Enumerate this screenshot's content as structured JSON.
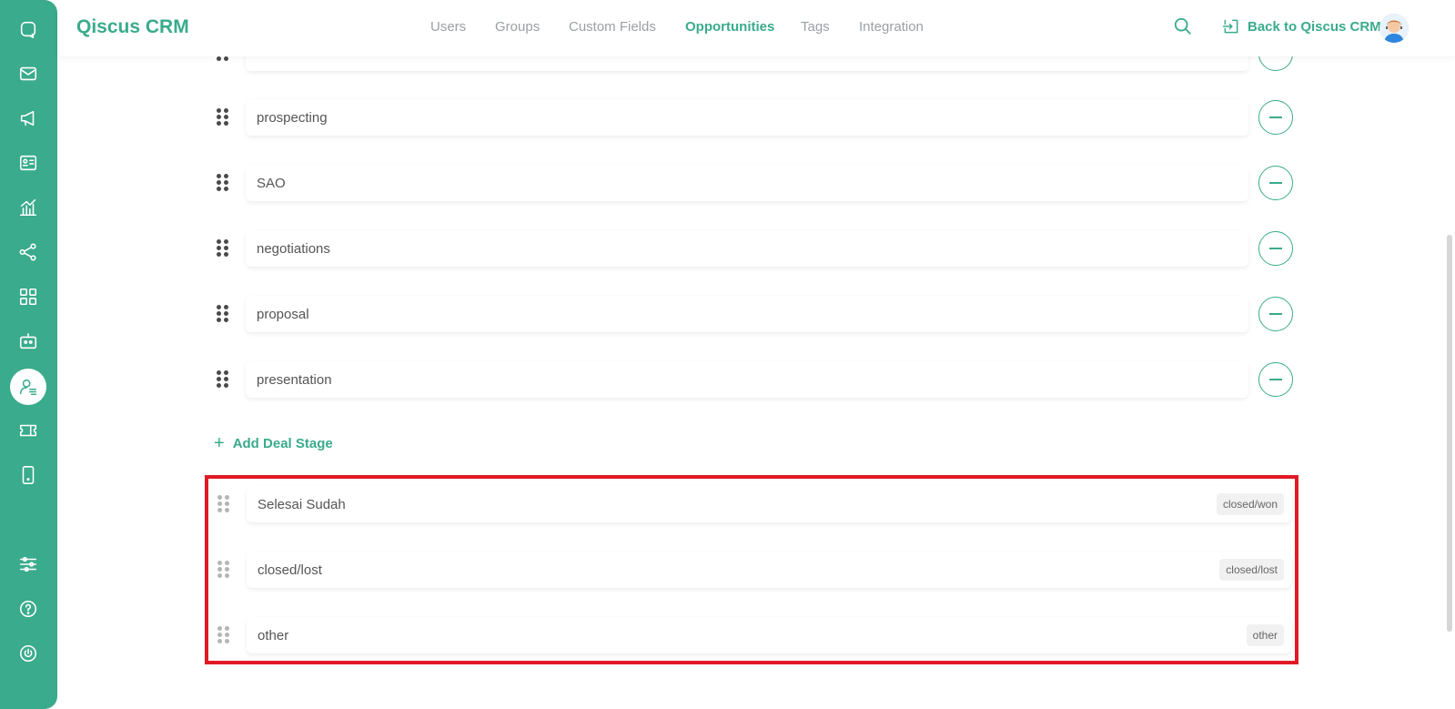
{
  "brand": "Qiscus CRM",
  "nav": [
    {
      "label": "Users",
      "active": false
    },
    {
      "label": "Groups",
      "active": false
    },
    {
      "label": "Custom Fields",
      "active": false
    },
    {
      "label": "Opportunities",
      "active": true
    },
    {
      "label": "Tags",
      "active": false
    },
    {
      "label": "Integration",
      "active": false
    }
  ],
  "header": {
    "back_label": "Back to Qiscus CRM"
  },
  "sidebar": {
    "icons": [
      "chat-icon",
      "mail-icon",
      "megaphone-icon",
      "contact-card-icon",
      "analytics-icon",
      "share-icon",
      "apps-icon",
      "robot-icon",
      "crm-user-icon",
      "ticket-icon",
      "mobile-icon",
      "settings-sliders-icon",
      "help-icon",
      "power-icon"
    ],
    "active": "crm-user-icon"
  },
  "stages": [
    {
      "name": ""
    },
    {
      "name": "prospecting"
    },
    {
      "name": "SAO"
    },
    {
      "name": "negotiations"
    },
    {
      "name": "proposal"
    },
    {
      "name": "presentation"
    }
  ],
  "add_stage_label": "Add Deal Stage",
  "fixed_stages": [
    {
      "name": "Selesai Sudah",
      "tag": "closed/won"
    },
    {
      "name": "closed/lost",
      "tag": "closed/lost"
    },
    {
      "name": "other",
      "tag": "other"
    }
  ],
  "colors": {
    "accent": "#3aab8c",
    "highlight": "#e01a26"
  }
}
